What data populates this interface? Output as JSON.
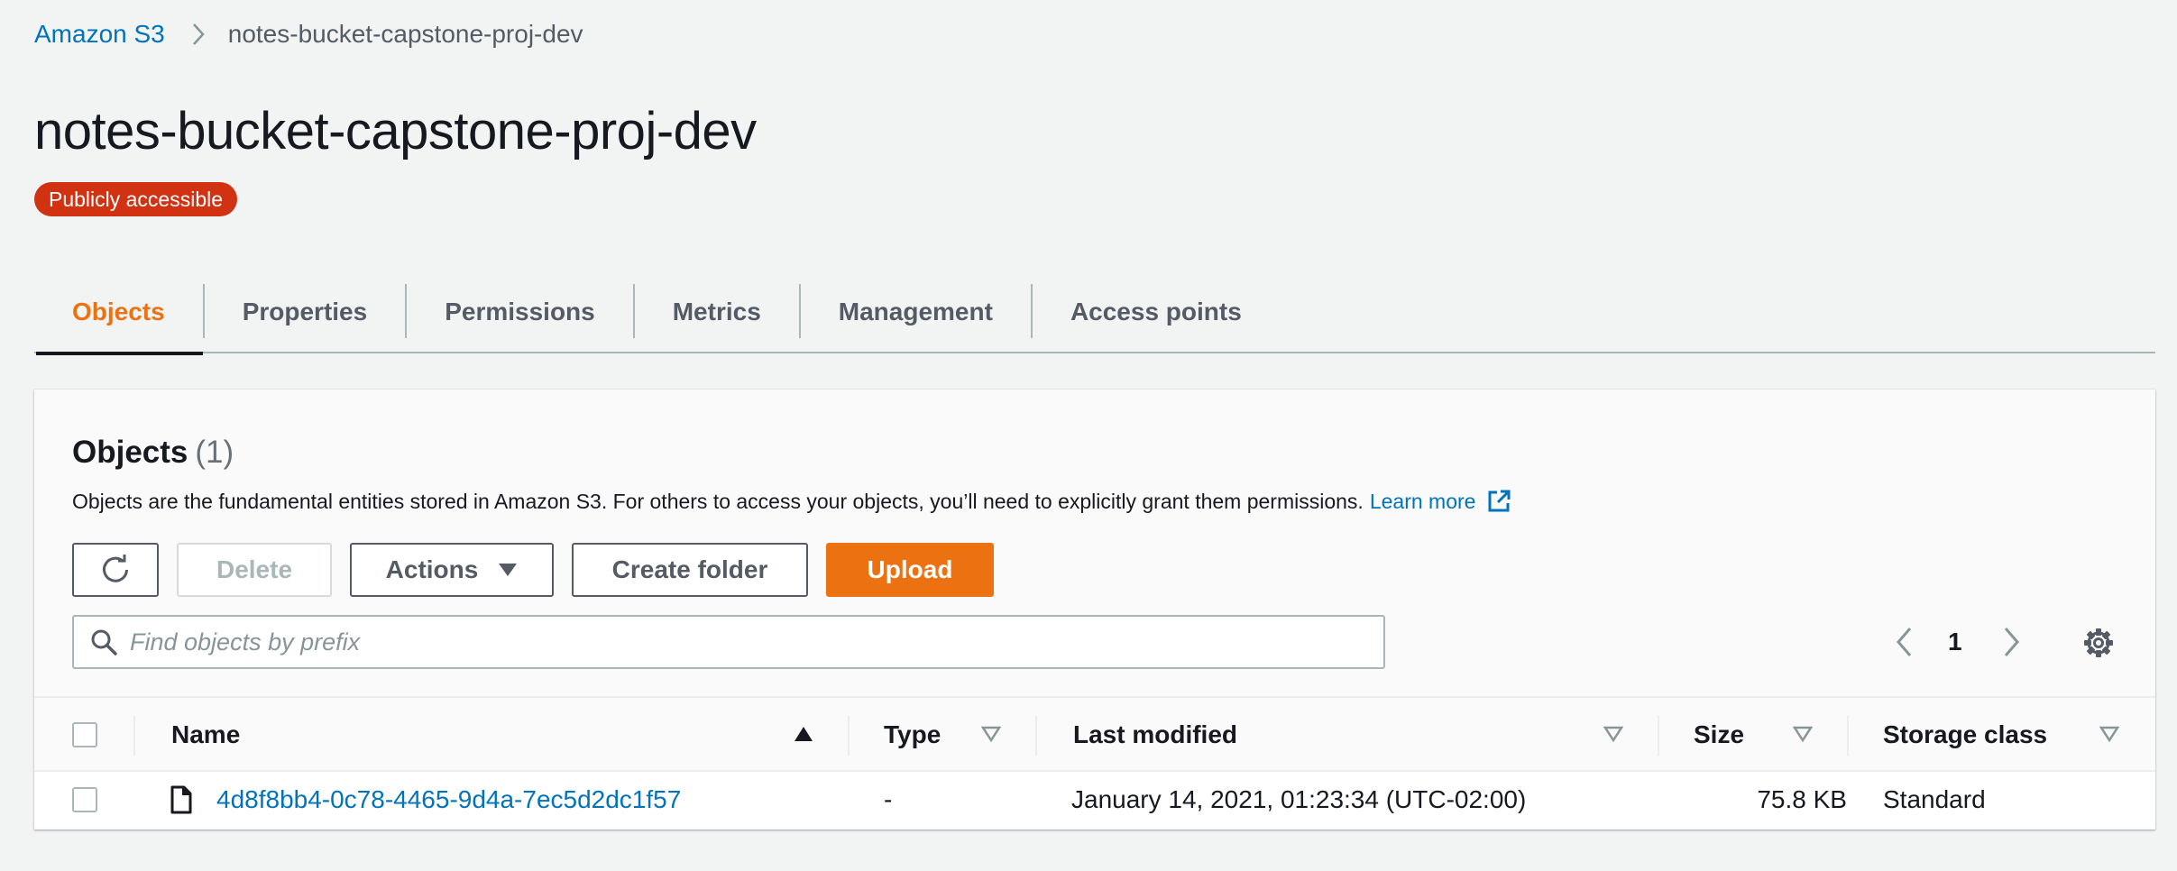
{
  "breadcrumb": {
    "root": "Amazon S3",
    "current": "notes-bucket-capstone-proj-dev"
  },
  "page": {
    "title": "notes-bucket-capstone-proj-dev",
    "badge": "Publicly accessible",
    "badge_color": "#d13212"
  },
  "tabs": [
    {
      "label": "Objects",
      "active": true
    },
    {
      "label": "Properties"
    },
    {
      "label": "Permissions"
    },
    {
      "label": "Metrics"
    },
    {
      "label": "Management"
    },
    {
      "label": "Access points"
    }
  ],
  "objects": {
    "title": "Objects",
    "count": "(1)",
    "description": "Objects are the fundamental entities stored in Amazon S3. For others to access your objects, you’ll need to explicitly grant them permissions.",
    "learn_more": "Learn more",
    "buttons": {
      "delete": "Delete",
      "actions": "Actions",
      "create_folder": "Create folder",
      "upload": "Upload"
    },
    "search": {
      "placeholder": "Find objects by prefix",
      "value": ""
    },
    "pagination": {
      "page": "1"
    },
    "columns": {
      "name": "Name",
      "type": "Type",
      "last_modified": "Last modified",
      "size": "Size",
      "storage_class": "Storage class"
    },
    "rows": [
      {
        "name": "4d8f8bb4-0c78-4465-9d4a-7ec5d2dc1f57",
        "type": "-",
        "last_modified": "January 14, 2021, 01:23:34 (UTC-02:00)",
        "size": "75.8 KB",
        "storage_class": "Standard"
      }
    ]
  },
  "colors": {
    "accent": "#ec7211",
    "link": "#0073bb",
    "danger": "#d13212"
  },
  "icons": [
    "chevron-right-icon",
    "refresh-icon",
    "caret-down-icon",
    "external-link-icon",
    "search-icon",
    "chevron-left-icon",
    "gear-icon",
    "sort-ascending-icon",
    "sort-icon",
    "file-icon"
  ]
}
